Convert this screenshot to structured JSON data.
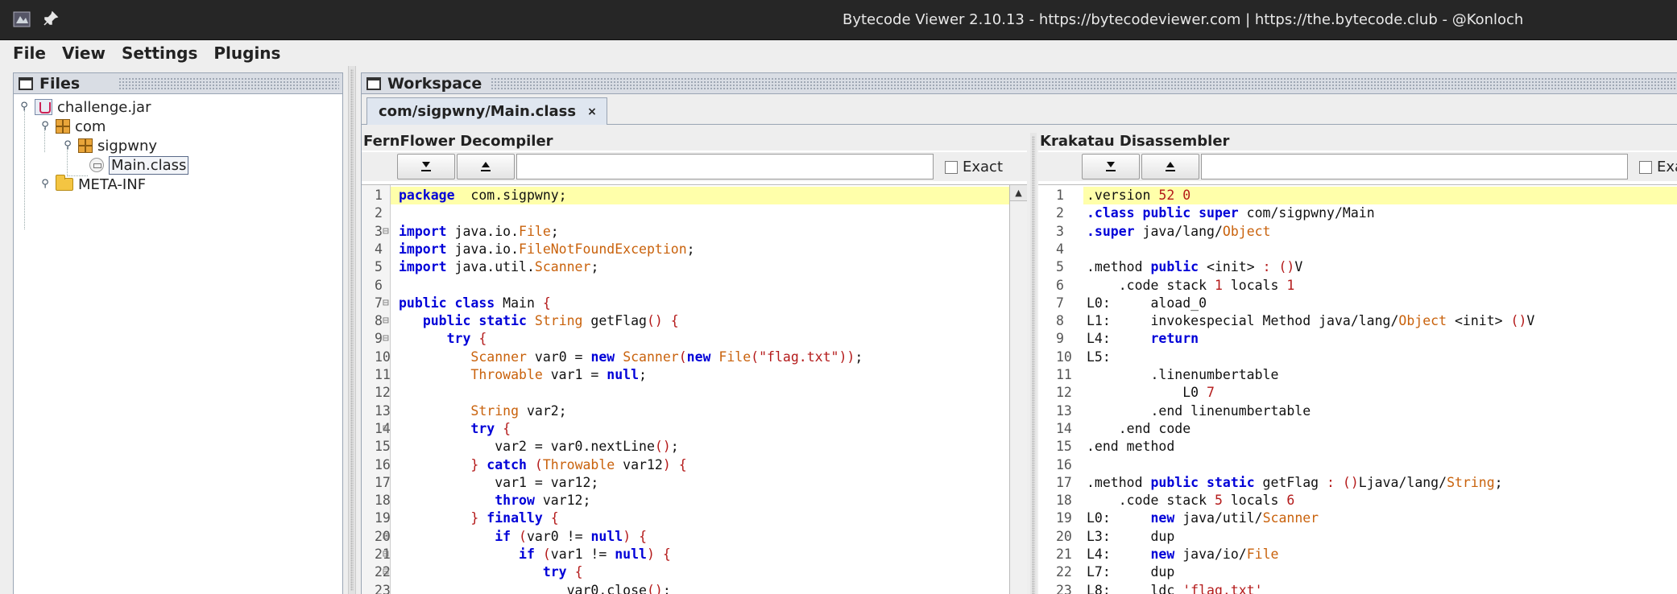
{
  "window": {
    "title": "Bytecode Viewer 2.10.13 - https://bytecodeviewer.com | https://the.bytecode.club - @Konloch"
  },
  "menu": [
    "File",
    "View",
    "Settings",
    "Plugins"
  ],
  "files_panel": {
    "title": "Files",
    "tree": [
      {
        "label": "challenge.jar",
        "icon": "jar-icon",
        "expanded": true
      },
      {
        "label": "com",
        "icon": "package-icon",
        "expanded": true
      },
      {
        "label": "sigpwny",
        "icon": "package-icon",
        "expanded": true
      },
      {
        "label": "Main.class",
        "icon": "class-file-icon",
        "selected": true
      },
      {
        "label": "META-INF",
        "icon": "folder-icon",
        "expanded": false
      }
    ]
  },
  "workspace": {
    "title": "Workspace",
    "tab": {
      "label": "com/sigpwny/Main.class",
      "close": "×"
    },
    "left_pane": {
      "title": "FernFlower Decompiler",
      "exact_label": "Exact",
      "lines": [
        {
          "n": "1",
          "fold": "",
          "hl": true,
          "parts": [
            [
              "kw",
              "package"
            ],
            [
              "",
              "  com.sigpwny;"
            ]
          ]
        },
        {
          "n": "2",
          "fold": "",
          "parts": []
        },
        {
          "n": "3",
          "fold": "⊟",
          "parts": [
            [
              "kw",
              "import"
            ],
            [
              "",
              " java.io."
            ],
            [
              "ty",
              "File"
            ],
            [
              "",
              ";"
            ]
          ]
        },
        {
          "n": "4",
          "fold": "",
          "parts": [
            [
              "kw",
              "import"
            ],
            [
              "",
              " java.io."
            ],
            [
              "ty",
              "FileNotFoundException"
            ],
            [
              "",
              ";"
            ]
          ]
        },
        {
          "n": "5",
          "fold": "",
          "parts": [
            [
              "kw",
              "import"
            ],
            [
              "",
              " java.util."
            ],
            [
              "ty",
              "Scanner"
            ],
            [
              "",
              ";"
            ]
          ]
        },
        {
          "n": "6",
          "fold": "",
          "parts": []
        },
        {
          "n": "7",
          "fold": "⊟",
          "parts": [
            [
              "kw",
              "public class"
            ],
            [
              "",
              " Main "
            ],
            [
              "br",
              "{"
            ]
          ]
        },
        {
          "n": "8",
          "fold": "⊟",
          "parts": [
            [
              "",
              "   "
            ],
            [
              "kw",
              "public static"
            ],
            [
              "",
              " "
            ],
            [
              "ty",
              "String"
            ],
            [
              "",
              " getFlag"
            ],
            [
              "br",
              "()"
            ],
            [
              "",
              " "
            ],
            [
              "br",
              "{"
            ]
          ]
        },
        {
          "n": "9",
          "fold": "⊟",
          "parts": [
            [
              "",
              "      "
            ],
            [
              "kw",
              "try"
            ],
            [
              "",
              " "
            ],
            [
              "br",
              "{"
            ]
          ]
        },
        {
          "n": "10",
          "fold": "",
          "parts": [
            [
              "",
              "         "
            ],
            [
              "ty",
              "Scanner"
            ],
            [
              "",
              " var0 = "
            ],
            [
              "kw",
              "new"
            ],
            [
              "",
              " "
            ],
            [
              "ty",
              "Scanner"
            ],
            [
              "br",
              "("
            ],
            [
              "kw",
              "new"
            ],
            [
              "",
              " "
            ],
            [
              "ty",
              "File"
            ],
            [
              "br",
              "("
            ],
            [
              "str",
              "\"flag.txt\""
            ],
            [
              "br",
              "))"
            ],
            [
              "",
              ";"
            ]
          ]
        },
        {
          "n": "11",
          "fold": "",
          "parts": [
            [
              "",
              "         "
            ],
            [
              "ty",
              "Throwable"
            ],
            [
              "",
              " var1 = "
            ],
            [
              "kw",
              "null"
            ],
            [
              "",
              ";"
            ]
          ]
        },
        {
          "n": "12",
          "fold": "",
          "parts": []
        },
        {
          "n": "13",
          "fold": "",
          "parts": [
            [
              "",
              "         "
            ],
            [
              "ty",
              "String"
            ],
            [
              "",
              " var2;"
            ]
          ]
        },
        {
          "n": "14",
          "fold": "⊟",
          "parts": [
            [
              "",
              "         "
            ],
            [
              "kw",
              "try"
            ],
            [
              "",
              " "
            ],
            [
              "br",
              "{"
            ]
          ]
        },
        {
          "n": "15",
          "fold": "",
          "parts": [
            [
              "",
              "            var2 = var0.nextLine"
            ],
            [
              "br",
              "()"
            ],
            [
              "",
              ";"
            ]
          ]
        },
        {
          "n": "16",
          "fold": "",
          "parts": [
            [
              "",
              "         "
            ],
            [
              "br",
              "}"
            ],
            [
              "",
              " "
            ],
            [
              "kw",
              "catch"
            ],
            [
              "",
              " "
            ],
            [
              "br",
              "("
            ],
            [
              "ty",
              "Throwable"
            ],
            [
              "",
              " var12"
            ],
            [
              "br",
              ")"
            ],
            [
              "",
              " "
            ],
            [
              "br",
              "{"
            ]
          ]
        },
        {
          "n": "17",
          "fold": "",
          "parts": [
            [
              "",
              "            var1 = var12;"
            ]
          ]
        },
        {
          "n": "18",
          "fold": "",
          "parts": [
            [
              "",
              "            "
            ],
            [
              "kw",
              "throw"
            ],
            [
              "",
              " var12;"
            ]
          ]
        },
        {
          "n": "19",
          "fold": "",
          "parts": [
            [
              "",
              "         "
            ],
            [
              "br",
              "}"
            ],
            [
              "",
              " "
            ],
            [
              "kw",
              "finally"
            ],
            [
              "",
              " "
            ],
            [
              "br",
              "{"
            ]
          ]
        },
        {
          "n": "20",
          "fold": "⊟",
          "parts": [
            [
              "",
              "            "
            ],
            [
              "kw",
              "if"
            ],
            [
              "",
              " "
            ],
            [
              "br",
              "("
            ],
            [
              "",
              "var0 != "
            ],
            [
              "kw",
              "null"
            ],
            [
              "br",
              ")"
            ],
            [
              "",
              " "
            ],
            [
              "br",
              "{"
            ]
          ]
        },
        {
          "n": "21",
          "fold": "⊟",
          "parts": [
            [
              "",
              "               "
            ],
            [
              "kw",
              "if"
            ],
            [
              "",
              " "
            ],
            [
              "br",
              "("
            ],
            [
              "",
              "var1 != "
            ],
            [
              "kw",
              "null"
            ],
            [
              "br",
              ")"
            ],
            [
              "",
              " "
            ],
            [
              "br",
              "{"
            ]
          ]
        },
        {
          "n": "22",
          "fold": "⊟",
          "parts": [
            [
              "",
              "                  "
            ],
            [
              "kw",
              "try"
            ],
            [
              "",
              " "
            ],
            [
              "br",
              "{"
            ]
          ]
        },
        {
          "n": "23",
          "fold": "",
          "parts": [
            [
              "",
              "                     var0.close"
            ],
            [
              "br",
              "()"
            ],
            [
              "",
              ";"
            ]
          ]
        }
      ]
    },
    "right_pane": {
      "title": "Krakatau Disassembler",
      "exact_label": "Exac",
      "lines": [
        {
          "n": "1",
          "hl": true,
          "parts": [
            [
              "",
              ".version "
            ],
            [
              "num",
              "52 0"
            ]
          ]
        },
        {
          "n": "2",
          "parts": [
            [
              "kw",
              ".class public super"
            ],
            [
              "",
              " com/sigpwny/Main"
            ]
          ]
        },
        {
          "n": "3",
          "parts": [
            [
              "kw",
              ".super"
            ],
            [
              "",
              " java/lang/"
            ],
            [
              "ty",
              "Object"
            ]
          ]
        },
        {
          "n": "4",
          "parts": []
        },
        {
          "n": "5",
          "parts": [
            [
              "",
              ".method "
            ],
            [
              "kw",
              "public"
            ],
            [
              "",
              " <init> "
            ],
            [
              "br",
              ":"
            ],
            [
              "",
              " "
            ],
            [
              "br",
              "()"
            ],
            [
              "",
              "V"
            ]
          ]
        },
        {
          "n": "6",
          "parts": [
            [
              "",
              "    .code stack "
            ],
            [
              "num",
              "1"
            ],
            [
              "",
              " locals "
            ],
            [
              "num",
              "1"
            ]
          ]
        },
        {
          "n": "7",
          "parts": [
            [
              "",
              "L0:     aload_0"
            ]
          ]
        },
        {
          "n": "8",
          "parts": [
            [
              "",
              "L1:     invokespecial Method java/lang/"
            ],
            [
              "ty",
              "Object"
            ],
            [
              "",
              " <init> "
            ],
            [
              "br",
              "()"
            ],
            [
              "",
              "V"
            ]
          ]
        },
        {
          "n": "9",
          "parts": [
            [
              "",
              "L4:     "
            ],
            [
              "kw",
              "return"
            ]
          ]
        },
        {
          "n": "10",
          "parts": [
            [
              "",
              "L5:"
            ]
          ]
        },
        {
          "n": "11",
          "parts": [
            [
              "",
              "        .linenumbertable"
            ]
          ]
        },
        {
          "n": "12",
          "parts": [
            [
              "",
              "            L0 "
            ],
            [
              "num",
              "7"
            ]
          ]
        },
        {
          "n": "13",
          "parts": [
            [
              "",
              "        .end linenumbertable"
            ]
          ]
        },
        {
          "n": "14",
          "parts": [
            [
              "",
              "    .end code"
            ]
          ]
        },
        {
          "n": "15",
          "parts": [
            [
              "",
              ".end method"
            ]
          ]
        },
        {
          "n": "16",
          "parts": []
        },
        {
          "n": "17",
          "parts": [
            [
              "",
              ".method "
            ],
            [
              "kw",
              "public static"
            ],
            [
              "",
              " getFlag "
            ],
            [
              "br",
              ":"
            ],
            [
              "",
              " "
            ],
            [
              "br",
              "()"
            ],
            [
              "",
              "Ljava/lang/"
            ],
            [
              "ty",
              "String"
            ],
            [
              "",
              ";"
            ]
          ]
        },
        {
          "n": "18",
          "parts": [
            [
              "",
              "    .code stack "
            ],
            [
              "num",
              "5"
            ],
            [
              "",
              " locals "
            ],
            [
              "num",
              "6"
            ]
          ]
        },
        {
          "n": "19",
          "parts": [
            [
              "",
              "L0:     "
            ],
            [
              "kw",
              "new"
            ],
            [
              "",
              " java/util/"
            ],
            [
              "ty",
              "Scanner"
            ]
          ]
        },
        {
          "n": "20",
          "parts": [
            [
              "",
              "L3:     dup"
            ]
          ]
        },
        {
          "n": "21",
          "parts": [
            [
              "",
              "L4:     "
            ],
            [
              "kw",
              "new"
            ],
            [
              "",
              " java/io/"
            ],
            [
              "ty",
              "File"
            ]
          ]
        },
        {
          "n": "22",
          "parts": [
            [
              "",
              "L7:     dup"
            ]
          ]
        },
        {
          "n": "23",
          "parts": [
            [
              "",
              "L8:     ldc "
            ],
            [
              "str",
              "'flag.txt'"
            ]
          ]
        }
      ]
    }
  }
}
